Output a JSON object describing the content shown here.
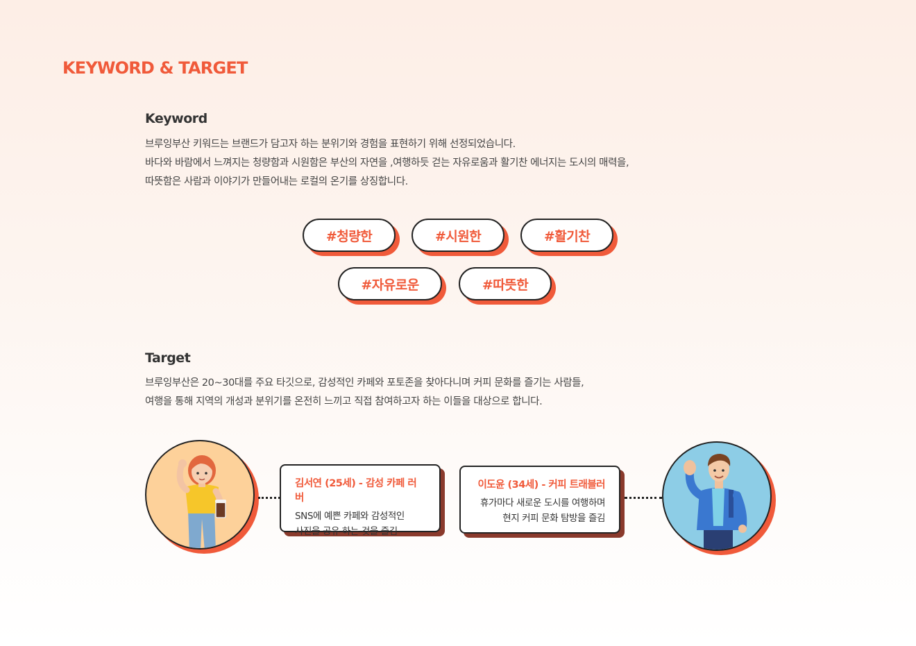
{
  "page_title": "KEYWORD & TARGET",
  "keyword": {
    "heading": "Keyword",
    "lines": [
      "브루잉부산 키워드는 브랜드가 담고자 하는 분위기와 경험을 표현하기 위해 선정되었습니다.",
      "바다와 바람에서 느껴지는 청량함과 시원함은 부산의 자연을 ,여행하듯 걷는 자유로움과 활기찬 에너지는 도시의 매력을,",
      "따뜻함은 사람과 이야기가 만들어내는 로컬의 온기를 상징합니다."
    ],
    "tags": [
      "#청량한",
      "#시원한",
      "#활기찬",
      "#자유로운",
      "#따뜻한"
    ]
  },
  "target": {
    "heading": "Target",
    "lines": [
      "브루잉부산은 20~30대를 주요 타깃으로, 감성적인 카페와 포토존을 찾아다니며 커피 문화를 즐기는 사람들,",
      "여행을 통해 지역의 개성과 분위기를 온전히 느끼고 직접 참여하고자 하는 이들을 대상으로 합니다."
    ],
    "personas": [
      {
        "name": "김서연 (25세) - 감성 카페 러버",
        "desc": [
          "SNS에 예쁜 카페와 감성적인",
          "사진을 공유 하는 것을 즐김"
        ]
      },
      {
        "name": "이도윤 (34세) - 커피 트래블러",
        "desc": [
          "휴가마다 새로운 도시를 여행하며",
          "현지 커피 문화 탐방을 즐김"
        ]
      }
    ]
  },
  "colors": {
    "accent": "#f05a3a",
    "card_shadow": "#8a3a2c",
    "outline": "#222222",
    "female_bg": "#fdd19a",
    "male_bg": "#8dcde6"
  }
}
